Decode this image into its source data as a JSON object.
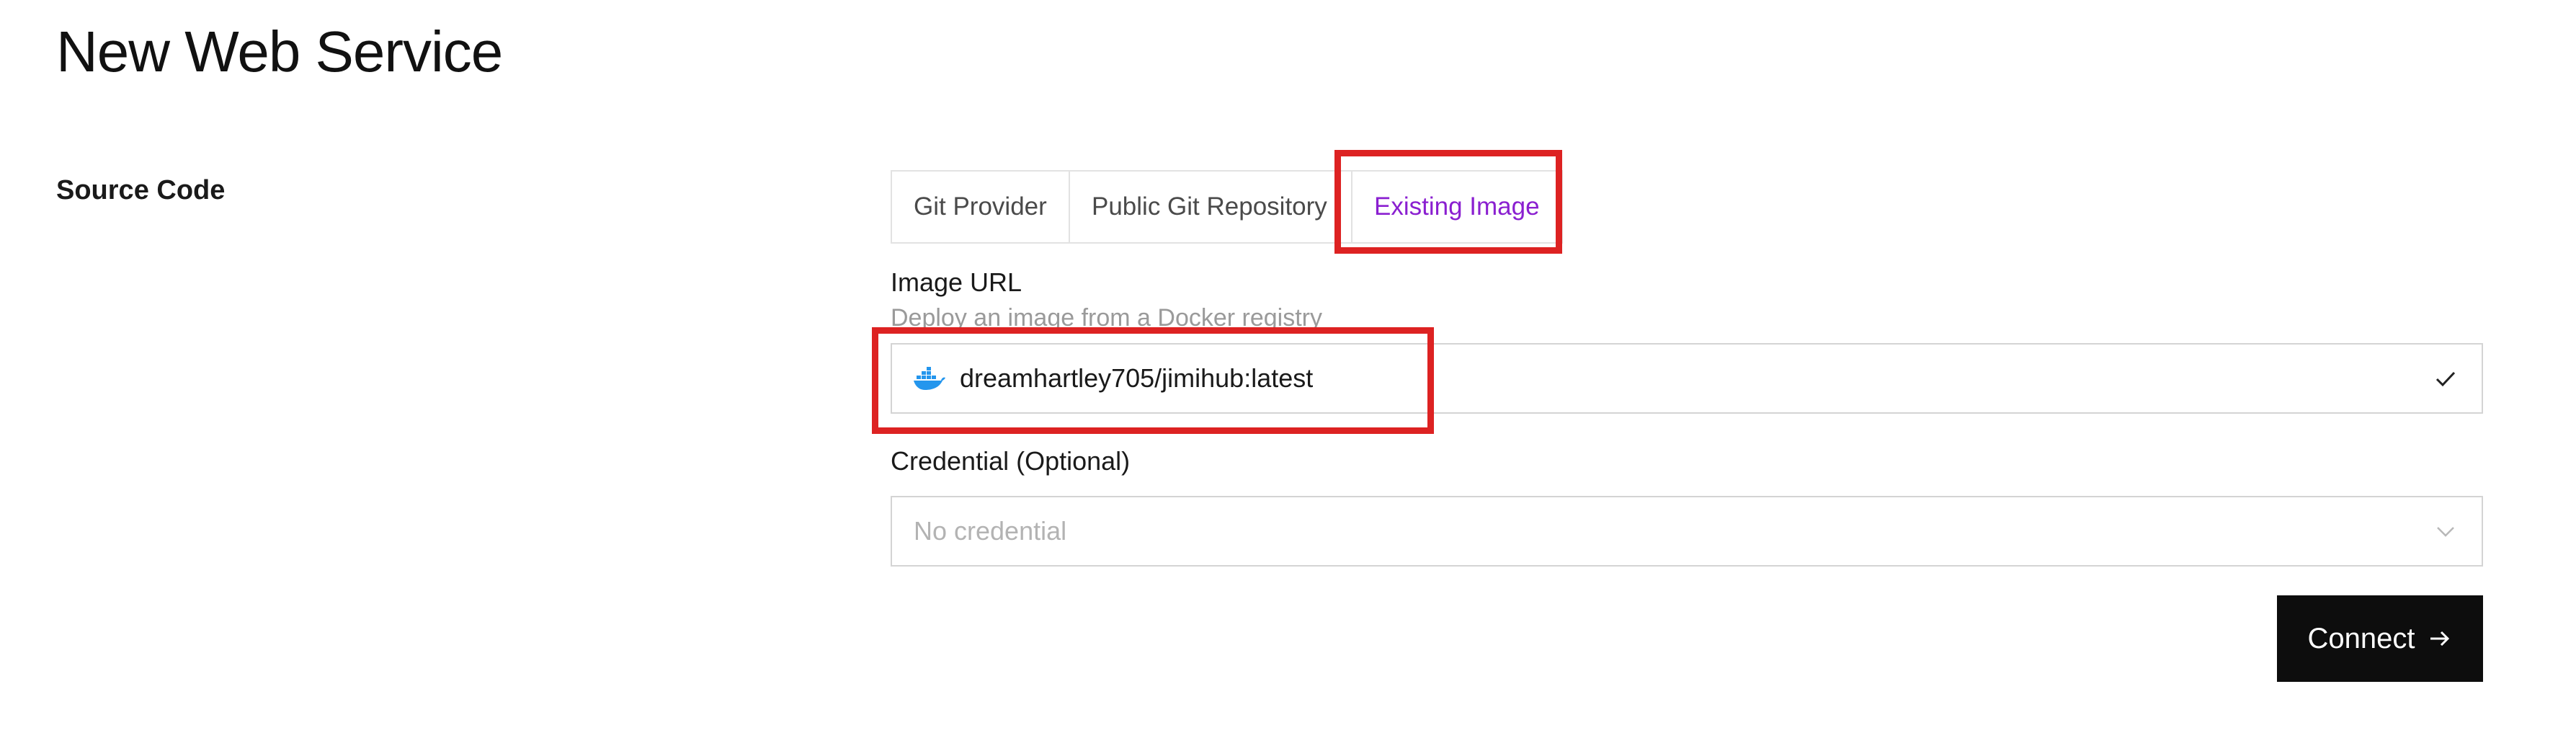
{
  "page": {
    "title": "New Web Service"
  },
  "source_section": {
    "label": "Source Code",
    "tabs": [
      {
        "label": "Git Provider",
        "active": false
      },
      {
        "label": "Public Git Repository",
        "active": false
      },
      {
        "label": "Existing Image",
        "active": true
      }
    ],
    "image_url": {
      "label": "Image URL",
      "hint": "Deploy an image from a Docker registry",
      "value": "dreamhartley705/jimihub:latest",
      "icon": "docker-icon",
      "status_icon": "check-icon"
    },
    "credential": {
      "label": "Credential (Optional)",
      "placeholder": "No credential",
      "icon": "chevron-down-icon"
    },
    "connect_button": {
      "label": "Connect",
      "icon": "arrow-right-icon"
    }
  },
  "colors": {
    "active_tab": "#8a1fd0",
    "highlight": "#dd2222",
    "button_bg": "#0d0d0d",
    "docker_blue": "#2496ed"
  }
}
